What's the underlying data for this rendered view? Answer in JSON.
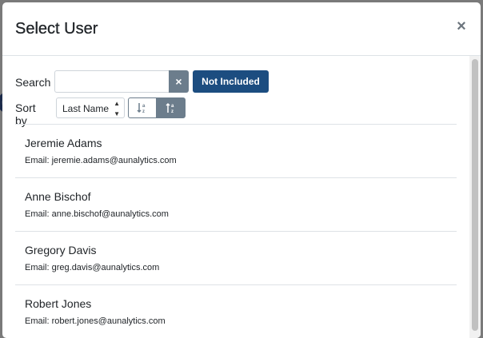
{
  "modal": {
    "title": "Select User",
    "close_symbol": "×"
  },
  "search": {
    "label": "Search",
    "value": "",
    "placeholder": "",
    "clear_symbol": "×",
    "not_included_label": "Not Included"
  },
  "sort": {
    "label": "Sort by",
    "selected": "Last Name",
    "asc_icon": "↓a/z",
    "desc_icon": "↑a/z"
  },
  "users": [
    {
      "name": "Jeremie Adams",
      "email": "Email: jeremie.adams@aunalytics.com"
    },
    {
      "name": "Anne Bischof",
      "email": "Email: anne.bischof@aunalytics.com"
    },
    {
      "name": "Gregory Davis",
      "email": "Email: greg.davis@aunalytics.com"
    },
    {
      "name": "Robert Jones",
      "email": "Email: robert.jones@aunalytics.com"
    }
  ],
  "colors": {
    "primary": "#1c4d80",
    "secondary": "#6c7d8c"
  }
}
